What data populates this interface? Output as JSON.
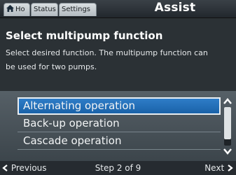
{
  "header": {
    "tabs": [
      {
        "label": "Ho",
        "icon": "home-icon"
      },
      {
        "label": "Status"
      },
      {
        "label": "Settings"
      }
    ],
    "title": "Assist"
  },
  "info": {
    "title": "Select multipump function",
    "description": "Select desired function. The multipump function can be used for two pumps."
  },
  "options": [
    {
      "label": "Alternating operation",
      "selected": true
    },
    {
      "label": "Back-up operation",
      "selected": false
    },
    {
      "label": "Cascade operation",
      "selected": false
    }
  ],
  "footer": {
    "previous_label": "Previous",
    "step_label": "Step 2 of 9",
    "next_label": "Next"
  },
  "colors": {
    "selection": "#1f6db5",
    "background": "#2e3439"
  }
}
